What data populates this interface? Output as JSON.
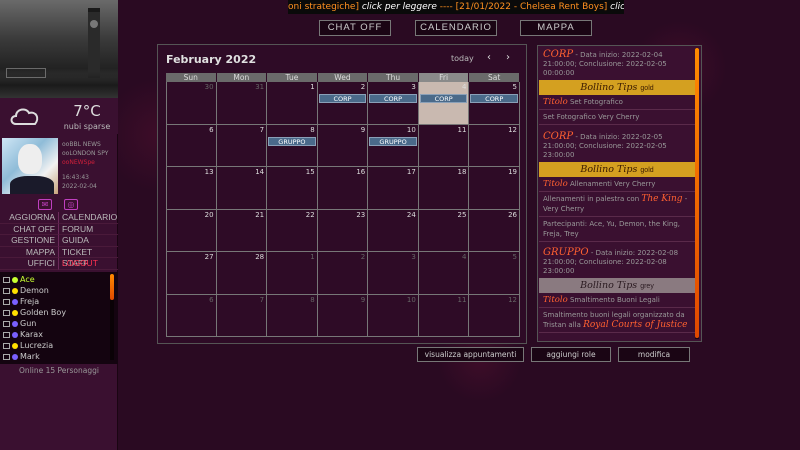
{
  "ticker": {
    "part1": "oni strategiche]",
    "part2": " click per leggere ",
    "part3": "---- [21/01/2022 - Chelsea Rent Boys]",
    "part4": " click per"
  },
  "topbar": {
    "chat_off": "CHAT OFF",
    "calendario": "CALENDARIO",
    "mappa": "MAPPA"
  },
  "weather": {
    "temp": "7°C",
    "desc": "nubi sparse"
  },
  "news": {
    "l1": "ooBBL NEWS",
    "l2": "ooLONDON SPY",
    "l3": "ooNEWSpe",
    "time": "16:43:43",
    "date": "2022-02-04"
  },
  "menu": {
    "left": [
      "AGGIORNA",
      "CHAT OFF",
      "GESTIONE",
      "MAPPA",
      "UFFICI"
    ],
    "right": [
      "CALENDARIO",
      "FORUM",
      "GUIDA",
      "TICKET STAFF",
      "LOGOUT"
    ]
  },
  "online": {
    "users": [
      {
        "name": "Ace",
        "dot": "#c8ff30"
      },
      {
        "name": "Demon",
        "dot": "#ffe000"
      },
      {
        "name": "Freja",
        "dot": "#7a60ff"
      },
      {
        "name": "Golden Boy",
        "dot": "#ffe000"
      },
      {
        "name": "Gun",
        "dot": "#7a60ff"
      },
      {
        "name": "Karax",
        "dot": "#7a60ff"
      },
      {
        "name": "Lucrezia",
        "dot": "#ffe000"
      },
      {
        "name": "Mark",
        "dot": "#7a60ff"
      }
    ],
    "count": "Online 15 Personaggi"
  },
  "calendar": {
    "title": "February 2022",
    "today": "today",
    "prev": "‹",
    "next": "›",
    "dow": [
      "Sun",
      "Mon",
      "Tue",
      "Wed",
      "Thu",
      "Fri",
      "Sat"
    ],
    "weeks": [
      [
        {
          "n": "30",
          "m": true
        },
        {
          "n": "31",
          "m": true
        },
        {
          "n": "1"
        },
        {
          "n": "2",
          "ev": "CORP"
        },
        {
          "n": "3",
          "ev": "CORP"
        },
        {
          "n": "4",
          "ev": "CORP",
          "today": true
        },
        {
          "n": "5",
          "ev": "CORP"
        }
      ],
      [
        {
          "n": "6"
        },
        {
          "n": "7"
        },
        {
          "n": "8",
          "ev": "GRUPPO"
        },
        {
          "n": "9"
        },
        {
          "n": "10",
          "ev": "GRUPPO"
        },
        {
          "n": "11"
        },
        {
          "n": "12"
        }
      ],
      [
        {
          "n": "13"
        },
        {
          "n": "14"
        },
        {
          "n": "15"
        },
        {
          "n": "16"
        },
        {
          "n": "17"
        },
        {
          "n": "18"
        },
        {
          "n": "19"
        }
      ],
      [
        {
          "n": "20"
        },
        {
          "n": "21"
        },
        {
          "n": "22"
        },
        {
          "n": "23"
        },
        {
          "n": "24"
        },
        {
          "n": "25"
        },
        {
          "n": "26"
        }
      ],
      [
        {
          "n": "27"
        },
        {
          "n": "28"
        },
        {
          "n": "1",
          "m": true
        },
        {
          "n": "2",
          "m": true
        },
        {
          "n": "3",
          "m": true
        },
        {
          "n": "4",
          "m": true
        },
        {
          "n": "5",
          "m": true
        }
      ],
      [
        {
          "n": "6",
          "m": true
        },
        {
          "n": "7",
          "m": true
        },
        {
          "n": "8",
          "m": true
        },
        {
          "n": "9",
          "m": true
        },
        {
          "n": "10",
          "m": true
        },
        {
          "n": "11",
          "m": true
        },
        {
          "n": "12",
          "m": true
        }
      ]
    ]
  },
  "panel": {
    "entries": [
      {
        "kind": "CORP",
        "dates": " - Data inizio: 2022-02-04 21:00:00; Conclusione: 2022-02-05 00:00:00",
        "tag": "Bollino Tips",
        "tag_color": "gold",
        "titolo_label": "Titolo",
        "titolo": " Set Fotografico",
        "desc": "Set Fotografico Very Cherry"
      },
      {
        "kind": "CORP",
        "dates": " - Data inizio: 2022-02-05 21:00:00; Conclusione: 2022-02-05 23:00:00",
        "tag": "Bollino Tips",
        "tag_color": "gold",
        "titolo_label": "Titolo",
        "titolo": " Allenamenti Very Cherry",
        "desc1": "Allenamenti in palestra con ",
        "desc1_big": "The King",
        "desc1_end": " - Very Cherry",
        "desc2": "Partecipanti: Ace, Yu, Demon, the King, Freja, Trey"
      },
      {
        "kind": "GRUPPO",
        "dates": " - Data inizio: 2022-02-08 21:00:00; Conclusione: 2022-02-08 23:00:00",
        "tag": "Bollino Tips",
        "tag_color": "grey",
        "titolo_label": "Titolo",
        "titolo": " Smaltimento Buoni Legali",
        "desc1": "Smaltimento buoni legali organizzato da Tristan alla ",
        "desc1_big": "Royal Courts of Justice"
      }
    ]
  },
  "buttons": {
    "appuntamenti": "visualizza appuntamenti",
    "ruolo": "aggiungi role",
    "modifica": "modifica"
  }
}
